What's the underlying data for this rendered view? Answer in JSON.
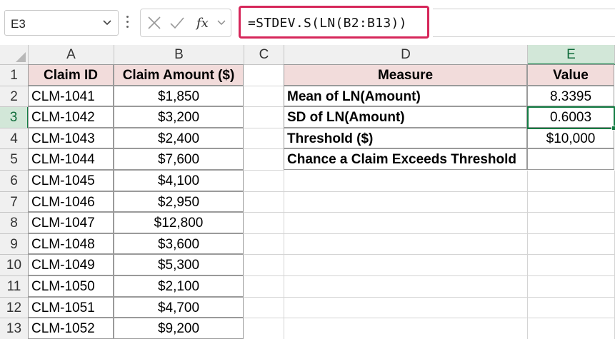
{
  "formula_bar": {
    "name_box": "E3",
    "formula": "=STDEV.S(LN(B2:B13))",
    "icons": [
      "chevron-down-icon",
      "cancel-x-icon",
      "enter-check-icon",
      "insert-function-icon"
    ]
  },
  "columns": [
    "A",
    "B",
    "C",
    "D",
    "E"
  ],
  "rows": [
    "1",
    "2",
    "3",
    "4",
    "5",
    "6",
    "7",
    "8",
    "9",
    "10",
    "11",
    "12",
    "13"
  ],
  "table_left": {
    "headers": [
      "Claim ID",
      "Claim Amount ($)"
    ],
    "rows": [
      [
        "CLM-1041",
        "$1,850"
      ],
      [
        "CLM-1042",
        "$3,200"
      ],
      [
        "CLM-1043",
        "$2,400"
      ],
      [
        "CLM-1044",
        "$7,600"
      ],
      [
        "CLM-1045",
        "$4,100"
      ],
      [
        "CLM-1046",
        "$2,950"
      ],
      [
        "CLM-1047",
        "$12,800"
      ],
      [
        "CLM-1048",
        "$3,600"
      ],
      [
        "CLM-1049",
        "$5,300"
      ],
      [
        "CLM-1050",
        "$2,100"
      ],
      [
        "CLM-1051",
        "$4,700"
      ],
      [
        "CLM-1052",
        "$9,200"
      ]
    ]
  },
  "table_right": {
    "headers": [
      "Measure",
      "Value"
    ],
    "rows": [
      [
        "Mean of LN(Amount)",
        "8.3395"
      ],
      [
        "SD of LN(Amount)",
        "0.6003"
      ],
      [
        "Threshold ($)",
        "$10,000"
      ],
      [
        "Chance a Claim Exceeds Threshold",
        ""
      ]
    ]
  },
  "colors": {
    "accent": "#137c43",
    "header_fill": "#f2dcdb",
    "formula_highlight": "#d6265a"
  }
}
